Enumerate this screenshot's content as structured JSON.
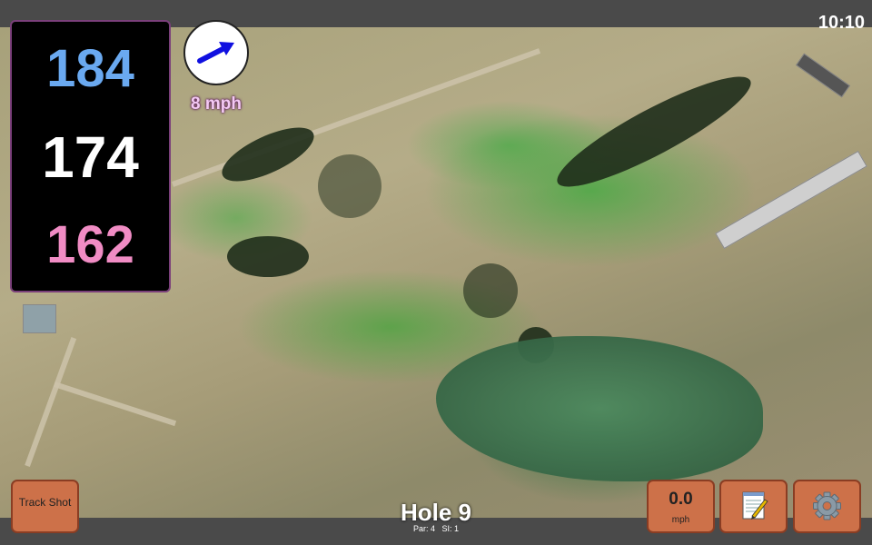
{
  "status": {
    "time": "10:10"
  },
  "yardages": {
    "back": "184",
    "middle": "174",
    "front": "162"
  },
  "wind": {
    "speed": "8 mph",
    "direction_icon": "arrow-icon"
  },
  "buttons": {
    "track_shot": "Track Shot",
    "speed_value": "0.0",
    "speed_unit": "mph",
    "notes_icon": "notepad-icon",
    "settings_icon": "gear-icon"
  },
  "hole": {
    "title": "Hole 9",
    "par": "Par: 4",
    "si": "SI: 1"
  },
  "colors": {
    "back_yardage": "#6aa9f0",
    "middle_yardage": "#ffffff",
    "front_yardage": "#f08cc4",
    "button_bg": "#cd7149",
    "wind_arrow": "#1010e0"
  }
}
